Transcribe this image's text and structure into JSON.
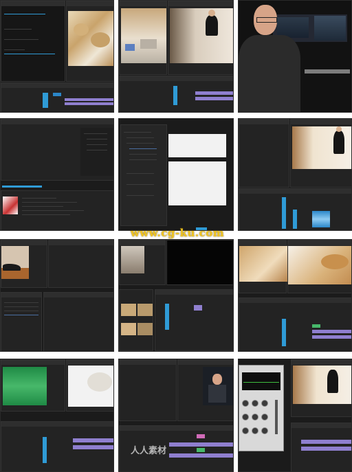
{
  "watermark": "www.cg-ku.com",
  "logo_watermark": "人人素材",
  "colors": {
    "panel_bg": "#232323",
    "accent_blue": "#2f9bd6",
    "clip_purple": "#8f7fcf",
    "clip_green": "#47b86a",
    "clip_pink": "#d06bb8",
    "watermark_gold": "#f0c420"
  },
  "tiles": [
    {
      "id": "t1",
      "content": "timeline-cookies",
      "icon": "video-thumbnail"
    },
    {
      "id": "t2",
      "content": "kitchen-scene"
    },
    {
      "id": "t3",
      "content": "instructor-studio"
    },
    {
      "id": "t4",
      "content": "media-browser"
    },
    {
      "id": "t5",
      "content": "export-dialog"
    },
    {
      "id": "t6",
      "content": "woman-kitchen"
    },
    {
      "id": "t7",
      "content": "shoe-clip"
    },
    {
      "id": "t8",
      "content": "multicam"
    },
    {
      "id": "t9",
      "content": "cookies-closeup"
    },
    {
      "id": "t10",
      "content": "audio-waveform"
    },
    {
      "id": "t11",
      "content": "instructor-preview"
    },
    {
      "id": "t12",
      "content": "audio-effects-knobs"
    }
  ]
}
